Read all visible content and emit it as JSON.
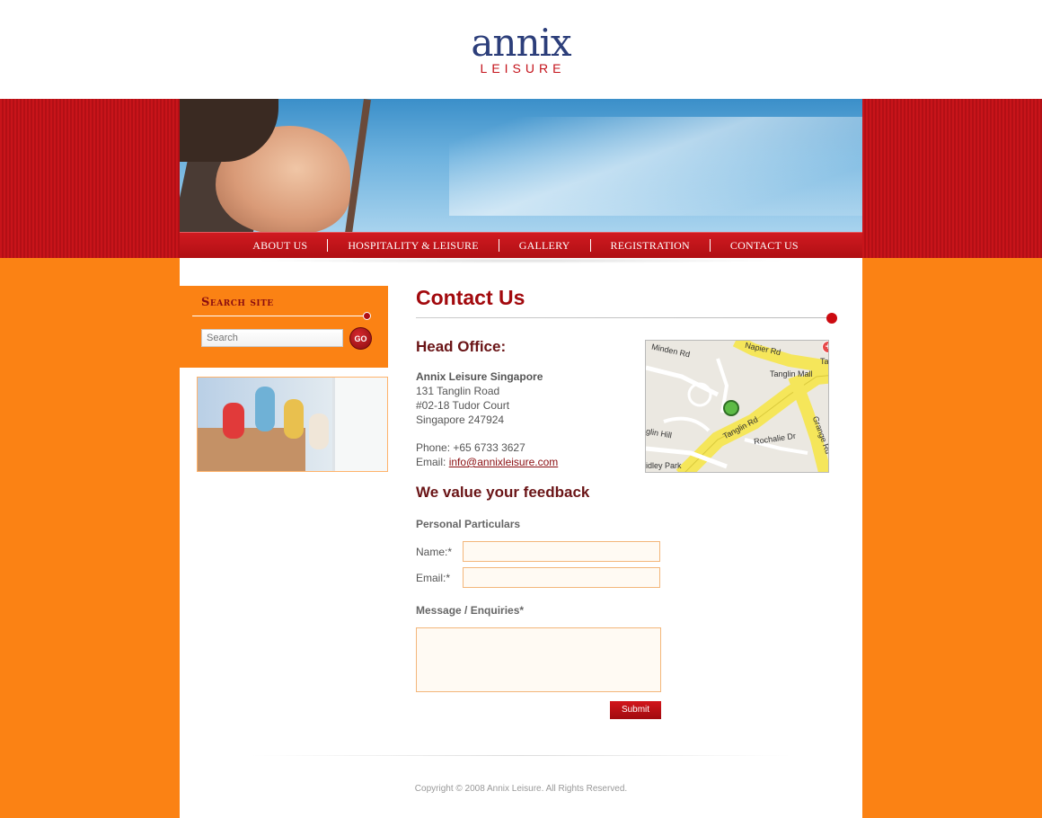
{
  "brand": {
    "logo_word": "annix",
    "logo_sub": "LEISURE",
    "accent": "#c4121a",
    "logo_blue": "#2c3e7a",
    "orange": "#fb8214"
  },
  "nav": {
    "items": [
      "ABOUT US",
      "HOSPITALITY & LEISURE",
      "GALLERY",
      "REGISTRATION",
      "CONTACT US"
    ]
  },
  "search": {
    "title": "Search site",
    "placeholder": "Search",
    "go_label": "GO"
  },
  "content": {
    "title": "Contact Us",
    "head_office": "Head Office:",
    "company": "Annix Leisure Singapore",
    "address_line1": "131 Tanglin Road",
    "address_line2": "#02-18 Tudor Court",
    "address_line3": "Singapore 247924",
    "phone": "Phone: +65 6733 3627",
    "email_label": "Email: ",
    "email": "info@annixleisure.com"
  },
  "map": {
    "labels": [
      "Minden Rd",
      "Napier Rd",
      "Tanglin Mall",
      "Tanglin Rd",
      "Rochalie Dr",
      "Grange Rd",
      "glin Hill",
      "idley Park",
      "Ta"
    ]
  },
  "feedback": {
    "title": "We value your feedback",
    "personal": "Personal Particulars",
    "name_label": "Name:*",
    "email_label": "Email:*",
    "message_label": "Message / Enquiries*",
    "submit_label": "Submit"
  },
  "footer": {
    "copyright": "Copyright © 2008 Annix Leisure. All Rights Reserved."
  }
}
